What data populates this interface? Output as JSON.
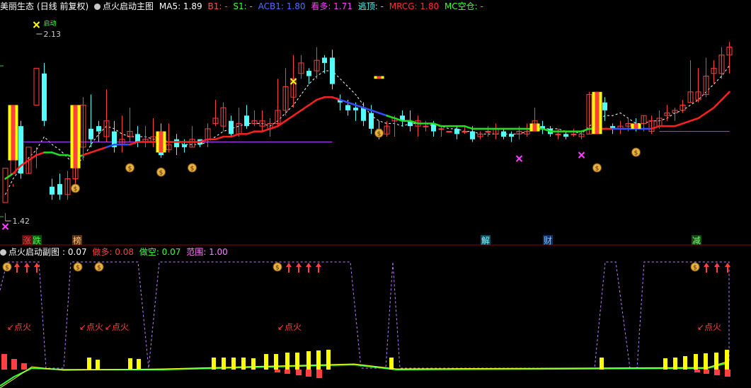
{
  "main_header": {
    "stock_name": "美丽生态",
    "period": "(日线 前复权)",
    "indicator": "点火启动主图",
    "ma5": "MA5: 1.89",
    "b1": "B1: -",
    "s1": "S1: -",
    "acb1": "ACB1: 1.80",
    "kanduo": "看多: 1.71",
    "taoding": "逃顶: -",
    "mrcg": "MRCG: 1.80",
    "mc_kongcang": "MC空仓: -"
  },
  "sub_header": {
    "indicator": "点火启动副图",
    "value": ": 0.07",
    "zuoduo": "做多: 0.08",
    "zuokong": "做空: 0.07",
    "fanwei": "范围: 1.00"
  },
  "price_labels": {
    "high": "2.13",
    "low": "1.42",
    "high_tag": "启动"
  },
  "event_labels": [
    {
      "text": "涨",
      "color": "#ff4040",
      "bg": "#5a1010"
    },
    {
      "text": "跌",
      "color": "#40ff40",
      "bg": "#104a10"
    },
    {
      "text": "榜",
      "color": "#ffc080",
      "bg": "#5a3510"
    },
    {
      "text": "解",
      "color": "#80ffff",
      "bg": "#104a5a"
    },
    {
      "text": "财",
      "color": "#80c0ff",
      "bg": "#103060"
    },
    {
      "text": "减",
      "color": "#80ff80",
      "bg": "#104a10"
    }
  ],
  "fire_label": "点火",
  "colors": {
    "up": "#ff4040",
    "down": "#54ffff",
    "ma5": "#ffffff",
    "trend_red": "#ff2020",
    "trend_green": "#20e020",
    "trend_blue": "#3050ff",
    "support": "#b040ff",
    "signal_yellow": "#ffff00",
    "sub_dashed": "#c080ff",
    "icon_money": "#e8b040"
  },
  "chart_data": {
    "type": "candlestick",
    "candles": [
      [
        1.49,
        1.62,
        1.45,
        1.42
      ],
      [
        1.6,
        1.78,
        1.56,
        1.55
      ],
      [
        1.78,
        1.6,
        1.8,
        1.58
      ],
      [
        1.6,
        1.7,
        1.6,
        1.66
      ],
      [
        1.86,
        2.0,
        1.7,
        1.62
      ],
      [
        1.98,
        1.8,
        2.02,
        1.78
      ],
      [
        1.55,
        1.52,
        1.58,
        1.5
      ],
      [
        1.56,
        1.52,
        1.6,
        1.5
      ],
      [
        1.52,
        1.58,
        1.61,
        1.5
      ],
      [
        1.58,
        1.63,
        1.62,
        1.56
      ],
      [
        1.7,
        1.86,
        1.89,
        1.65
      ],
      [
        1.77,
        1.73,
        1.9,
        1.7
      ],
      [
        1.78,
        1.76,
        1.8,
        1.72
      ],
      [
        1.74,
        1.8,
        1.92,
        1.72
      ],
      [
        1.76,
        1.7,
        1.8,
        1.68
      ],
      [
        1.71,
        1.73,
        1.82,
        1.68
      ],
      [
        1.74,
        1.76,
        1.85,
        1.72
      ],
      [
        1.75,
        1.72,
        1.78,
        1.7
      ],
      [
        1.72,
        1.73,
        1.78,
        1.7
      ],
      [
        1.72,
        1.74,
        1.81,
        1.7
      ],
      [
        1.74,
        1.67,
        1.79,
        1.66
      ],
      [
        1.69,
        1.71,
        1.79,
        1.68
      ],
      [
        1.73,
        1.7,
        1.75,
        1.67
      ],
      [
        1.71,
        1.7,
        1.73,
        1.68
      ],
      [
        1.7,
        1.73,
        1.78,
        1.7
      ],
      [
        1.73,
        1.71,
        1.73,
        1.7
      ],
      [
        1.73,
        1.77,
        1.79,
        1.7
      ],
      [
        1.79,
        1.81,
        1.88,
        1.78
      ],
      [
        1.78,
        1.85,
        1.87,
        1.76
      ],
      [
        1.8,
        1.75,
        1.82,
        1.74
      ],
      [
        1.75,
        1.79,
        1.85,
        1.74
      ],
      [
        1.82,
        1.78,
        1.86,
        1.77
      ],
      [
        1.79,
        1.8,
        1.84,
        1.78
      ],
      [
        1.78,
        1.8,
        1.84,
        1.76
      ],
      [
        1.77,
        1.79,
        1.81,
        1.74
      ],
      [
        1.79,
        1.84,
        1.96,
        1.78
      ],
      [
        1.84,
        1.93,
        2.0,
        1.82
      ],
      [
        1.89,
        1.96,
        2.05,
        1.85
      ],
      [
        1.98,
        2.02,
        2.05,
        1.96
      ],
      [
        1.99,
        1.97,
        2.0,
        1.94
      ],
      [
        1.99,
        2.03,
        2.08,
        1.96
      ],
      [
        2.04,
        2.02,
        2.05,
        1.98
      ],
      [
        2.04,
        1.94,
        2.07,
        1.92
      ],
      [
        1.88,
        1.87,
        1.9,
        1.84
      ],
      [
        1.86,
        1.84,
        1.88,
        1.82
      ],
      [
        1.85,
        1.84,
        1.87,
        1.8
      ],
      [
        1.85,
        1.8,
        1.87,
        1.78
      ],
      [
        1.83,
        1.77,
        1.86,
        1.75
      ],
      [
        1.77,
        1.75,
        1.8,
        1.73
      ],
      [
        1.75,
        1.78,
        1.8,
        1.74
      ],
      [
        1.8,
        1.81,
        1.82,
        1.74
      ],
      [
        1.82,
        1.8,
        1.84,
        1.78
      ],
      [
        1.8,
        1.78,
        1.84,
        1.76
      ],
      [
        1.78,
        1.8,
        1.82,
        1.74
      ],
      [
        1.78,
        1.78,
        1.8,
        1.76
      ],
      [
        1.79,
        1.76,
        1.8,
        1.74
      ],
      [
        1.77,
        1.77,
        1.78,
        1.74
      ],
      [
        1.76,
        1.76,
        1.76,
        1.76
      ],
      [
        1.77,
        1.75,
        1.78,
        1.73
      ],
      [
        1.76,
        1.76,
        1.78,
        1.75
      ],
      [
        1.76,
        1.73,
        1.78,
        1.72
      ],
      [
        1.74,
        1.75,
        1.76,
        1.73
      ],
      [
        1.76,
        1.76,
        1.78,
        1.74
      ],
      [
        1.75,
        1.77,
        1.79,
        1.73
      ],
      [
        1.76,
        1.74,
        1.77,
        1.73
      ],
      [
        1.75,
        1.74,
        1.76,
        1.72
      ],
      [
        1.75,
        1.76,
        1.78,
        1.73
      ],
      [
        1.75,
        1.76,
        1.79,
        1.74
      ],
      [
        1.78,
        1.8,
        1.85,
        1.77
      ],
      [
        1.78,
        1.77,
        1.8,
        1.75
      ],
      [
        1.77,
        1.75,
        1.78,
        1.74
      ],
      [
        1.75,
        1.75,
        1.77,
        1.73
      ],
      [
        1.75,
        1.74,
        1.76,
        1.73
      ],
      [
        1.75,
        1.75,
        1.77,
        1.74
      ],
      [
        1.74,
        1.75,
        1.76,
        1.73
      ],
      [
        1.75,
        1.9,
        1.91,
        1.75
      ],
      [
        1.85,
        1.86,
        1.88,
        1.8
      ],
      [
        1.87,
        1.84,
        1.89,
        1.8
      ],
      [
        1.78,
        1.77,
        1.79,
        1.75
      ],
      [
        1.77,
        1.78,
        1.8,
        1.75
      ],
      [
        1.78,
        1.79,
        1.81,
        1.76
      ],
      [
        1.79,
        1.78,
        1.81,
        1.76
      ],
      [
        1.79,
        1.82,
        1.82,
        1.76
      ],
      [
        1.76,
        1.8,
        1.82,
        1.75
      ],
      [
        1.78,
        1.81,
        1.84,
        1.77
      ],
      [
        1.82,
        1.83,
        1.86,
        1.8
      ],
      [
        1.83,
        1.84,
        1.85,
        1.8
      ],
      [
        1.84,
        1.86,
        1.88,
        1.83
      ],
      [
        1.87,
        1.91,
        2.03,
        1.87
      ],
      [
        1.88,
        1.91,
        2.0,
        1.87
      ],
      [
        1.9,
        1.97,
        2.04,
        1.89
      ],
      [
        1.98,
        2.0,
        2.03,
        1.94
      ],
      [
        1.98,
        2.05,
        2.08,
        1.96
      ],
      [
        2.05,
        2.08,
        2.1,
        1.98
      ]
    ],
    "ma5": [
      1.52,
      1.58,
      1.62,
      1.66,
      1.69,
      1.74,
      1.71,
      1.69,
      1.66,
      1.63,
      1.66,
      1.71,
      1.75,
      1.78,
      1.77,
      1.75,
      1.74,
      1.74,
      1.74,
      1.73,
      1.73,
      1.72,
      1.72,
      1.71,
      1.71,
      1.71,
      1.72,
      1.74,
      1.76,
      1.77,
      1.78,
      1.79,
      1.79,
      1.79,
      1.78,
      1.8,
      1.83,
      1.86,
      1.9,
      1.94,
      1.97,
      1.99,
      1.99,
      1.96,
      1.93,
      1.9,
      1.86,
      1.82,
      1.8,
      1.79,
      1.79,
      1.78,
      1.79,
      1.79,
      1.79,
      1.78,
      1.78,
      1.77,
      1.77,
      1.76,
      1.76,
      1.75,
      1.75,
      1.75,
      1.75,
      1.75,
      1.75,
      1.76,
      1.77,
      1.77,
      1.77,
      1.77,
      1.76,
      1.76,
      1.75,
      1.78,
      1.8,
      1.82,
      1.82,
      1.83,
      1.81,
      1.79,
      1.79,
      1.8,
      1.8,
      1.81,
      1.83,
      1.84,
      1.86,
      1.88,
      1.91,
      1.94,
      1.97,
      2.01
    ],
    "trend": [
      1.58,
      1.6,
      1.63,
      1.65,
      1.67,
      1.68,
      1.68,
      1.67,
      1.67,
      1.66,
      1.67,
      1.68,
      1.69,
      1.7,
      1.71,
      1.71,
      1.71,
      1.72,
      1.72,
      1.72,
      1.72,
      1.72,
      1.72,
      1.72,
      1.72,
      1.72,
      1.73,
      1.73,
      1.74,
      1.74,
      1.75,
      1.75,
      1.76,
      1.76,
      1.77,
      1.78,
      1.8,
      1.82,
      1.84,
      1.86,
      1.88,
      1.89,
      1.89,
      1.88,
      1.87,
      1.86,
      1.85,
      1.84,
      1.83,
      1.82,
      1.81,
      1.8,
      1.8,
      1.79,
      1.79,
      1.79,
      1.78,
      1.78,
      1.78,
      1.78,
      1.77,
      1.77,
      1.77,
      1.77,
      1.77,
      1.77,
      1.77,
      1.77,
      1.77,
      1.77,
      1.76,
      1.76,
      1.76,
      1.76,
      1.76,
      1.77,
      1.77,
      1.77,
      1.77,
      1.77,
      1.77,
      1.77,
      1.77,
      1.77,
      1.78,
      1.78,
      1.78,
      1.79,
      1.8,
      1.81,
      1.83,
      1.85,
      1.88,
      1.91
    ]
  }
}
